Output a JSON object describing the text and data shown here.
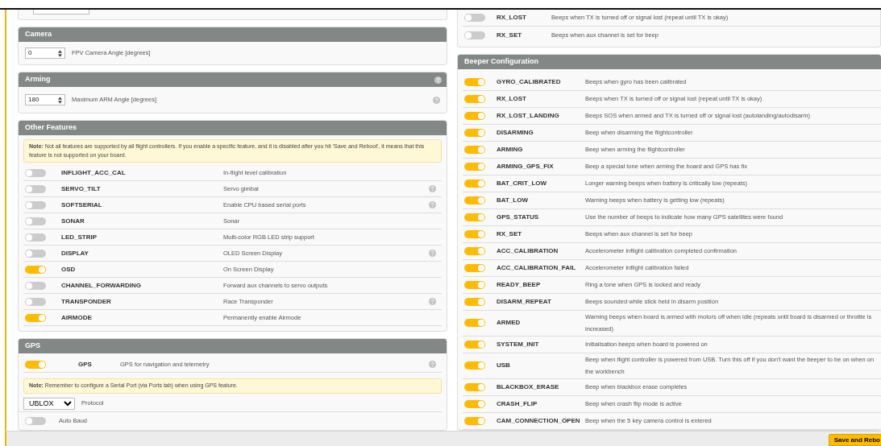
{
  "left_column": {
    "camera": {
      "title": "Camera",
      "value": "0",
      "label": "FPV Camera Angle [degrees]",
      "help": false
    },
    "arming": {
      "title": "Arming",
      "title_help": true,
      "value": "180",
      "label": "Maximum ARM Angle [degrees]",
      "help": true
    },
    "other_features": {
      "title": "Other Features",
      "note": "**Note:** Not all features are supported by all flight controllers. If you enable a specific feature, and it is disabled after you hit 'Save and Reboot', it means that this feature is not supported on your board.",
      "features": [
        {
          "name": "INFLIGHT_ACC_CAL",
          "description": "In-flight level calibration",
          "on": false,
          "help": false
        },
        {
          "name": "SERVO_TILT",
          "description": "Servo gimbal",
          "on": false,
          "help": true
        },
        {
          "name": "SOFTSERIAL",
          "description": "Enable CPU based serial ports",
          "on": false,
          "help": true
        },
        {
          "name": "SONAR",
          "description": "Sonar",
          "on": false,
          "help": false
        },
        {
          "name": "LED_STRIP",
          "description": "Multi-color RGB LED strip support",
          "on": false,
          "help": false
        },
        {
          "name": "DISPLAY",
          "description": "OLED Screen Display",
          "on": false,
          "help": true
        },
        {
          "name": "OSD",
          "description": "On Screen Display",
          "on": true,
          "help": false
        },
        {
          "name": "CHANNEL_FORWARDING",
          "description": "Forward aux channels to servo outputs",
          "on": false,
          "help": false
        },
        {
          "name": "TRANSPONDER",
          "description": "Race Transponder",
          "on": false,
          "help": true
        },
        {
          "name": "AIRMODE",
          "description": "Permanently enable Airmode",
          "on": true,
          "help": false
        }
      ]
    },
    "gps": {
      "title": "GPS",
      "feature": {
        "name": "GPS",
        "description": "GPS for navigation and telemetry",
        "on": true,
        "help": true
      },
      "note": "**Note:** Remember to configure a Serial Port (via Ports tab) when using GPS feature.",
      "protocol": {
        "value": "UBLOX",
        "label": "Protocol"
      },
      "auto_baud": {
        "label": "Auto Baud",
        "on": false
      }
    }
  },
  "right_column": {
    "partial_rows": [
      {
        "name": "RX_LOST",
        "description": "Beeps when TX is turned off or signal lost (repeat until TX is okay)",
        "on": false
      },
      {
        "name": "RX_SET",
        "description": "Beeps when aux channel is set for beep",
        "on": false
      }
    ],
    "beeper": {
      "title": "Beeper Configuration",
      "rows": [
        {
          "name": "GYRO_CALIBRATED",
          "description": "Beeps when gyro has been calibrated",
          "on": true
        },
        {
          "name": "RX_LOST",
          "description": "Beeps when TX is turned off or signal lost (repeat until TX is okay)",
          "on": true
        },
        {
          "name": "RX_LOST_LANDING",
          "description": "Beeps SOS when armed and TX is turned off or signal lost (autolanding/autodisarm)",
          "on": true
        },
        {
          "name": "DISARMING",
          "description": "Beep when disarming the flightcontroller",
          "on": true
        },
        {
          "name": "ARMING",
          "description": "Beep when arming the flightcontroller",
          "on": true
        },
        {
          "name": "ARMING_GPS_FIX",
          "description": "Beep a special tone when arming the board and GPS has fix",
          "on": true
        },
        {
          "name": "BAT_CRIT_LOW",
          "description": "Longer warning beeps when battery is critically low (repeats)",
          "on": true
        },
        {
          "name": "BAT_LOW",
          "description": "Warning beeps when battery is getting low (repeats)",
          "on": true
        },
        {
          "name": "GPS_STATUS",
          "description": "Use the number of beeps to indicate how many GPS satellites were found",
          "on": true
        },
        {
          "name": "RX_SET",
          "description": "Beeps when aux channel is set for beep",
          "on": true
        },
        {
          "name": "ACC_CALIBRATION",
          "description": "Accelerometer inflight calibration completed confirmation",
          "on": true
        },
        {
          "name": "ACC_CALIBRATION_FAIL",
          "description": "Accelerometer inflight calibration failed",
          "on": true
        },
        {
          "name": "READY_BEEP",
          "description": "Ring a tone when GPS is locked and ready",
          "on": true
        },
        {
          "name": "DISARM_REPEAT",
          "description": "Beeps sounded while stick held in disarm position",
          "on": true
        },
        {
          "name": "ARMED",
          "description": "Warning beeps when board is armed with motors off when idle (repeats until board is disarmed or throttle is increased)",
          "on": true
        },
        {
          "name": "SYSTEM_INIT",
          "description": "Initialisation beeps when board is powered on",
          "on": true
        },
        {
          "name": "USB",
          "description": "Beep when flight controller is powered from USB. Turn this off if you don't want the beeper to be on when on the workbench",
          "on": true
        },
        {
          "name": "BLACKBOX_ERASE",
          "description": "Beep when blackbox erase completes",
          "on": true
        },
        {
          "name": "CRASH_FLIP",
          "description": "Beep when crash flip mode is active",
          "on": true
        },
        {
          "name": "CAM_CONNECTION_OPEN",
          "description": "Beep when the 5 key camera control is entered",
          "on": true
        }
      ]
    }
  },
  "save_button": "Save and Rebo"
}
